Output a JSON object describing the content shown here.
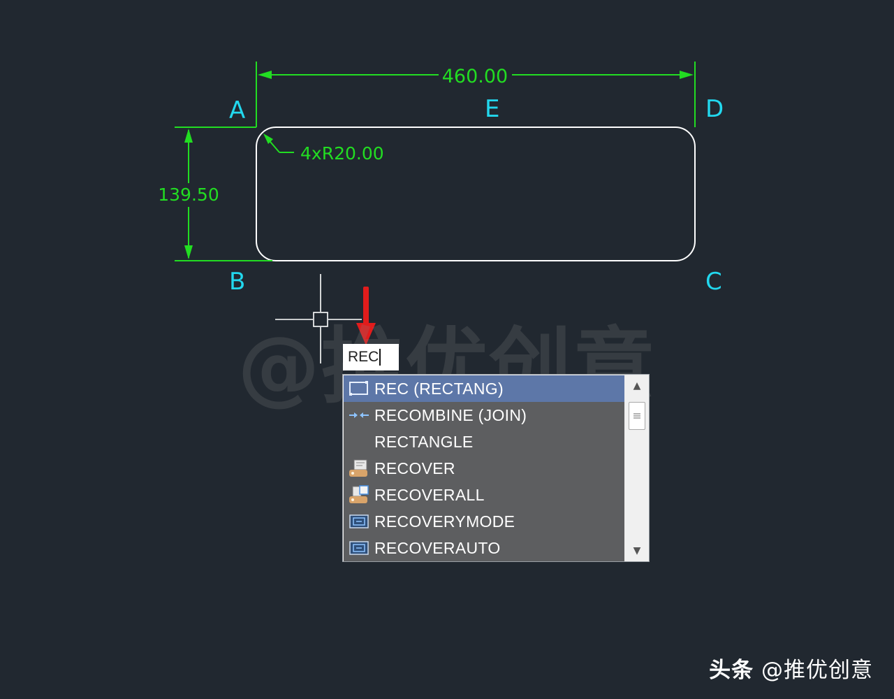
{
  "drawing": {
    "points": {
      "a": "A",
      "b": "B",
      "c": "C",
      "d": "D",
      "e": "E"
    },
    "dims": {
      "width": "460.00",
      "height": "139.50",
      "radius": "4xR20.00"
    },
    "colors": {
      "background": "#212830",
      "dimension": "#22dd22",
      "point_label": "#22d8ee",
      "outline": "#ffffff",
      "arrow": "#e11c1c"
    }
  },
  "watermark": "@推优创意",
  "command_input": {
    "value": "REC"
  },
  "autocomplete": {
    "items": [
      {
        "label": "REC (RECTANG)",
        "icon": "rectangle-icon"
      },
      {
        "label": "RECOMBINE (JOIN)",
        "icon": "join-icon"
      },
      {
        "label": "RECTANGLE",
        "icon": ""
      },
      {
        "label": "RECOVER",
        "icon": "recover-icon"
      },
      {
        "label": "RECOVERALL",
        "icon": "recoverall-icon"
      },
      {
        "label": "RECOVERYMODE",
        "icon": "recovery-mode-icon"
      },
      {
        "label": "RECOVERAUTO",
        "icon": "recovery-auto-icon"
      }
    ],
    "selected_index": 0
  },
  "footer": {
    "brand": "头条",
    "handle": "@推优创意"
  }
}
